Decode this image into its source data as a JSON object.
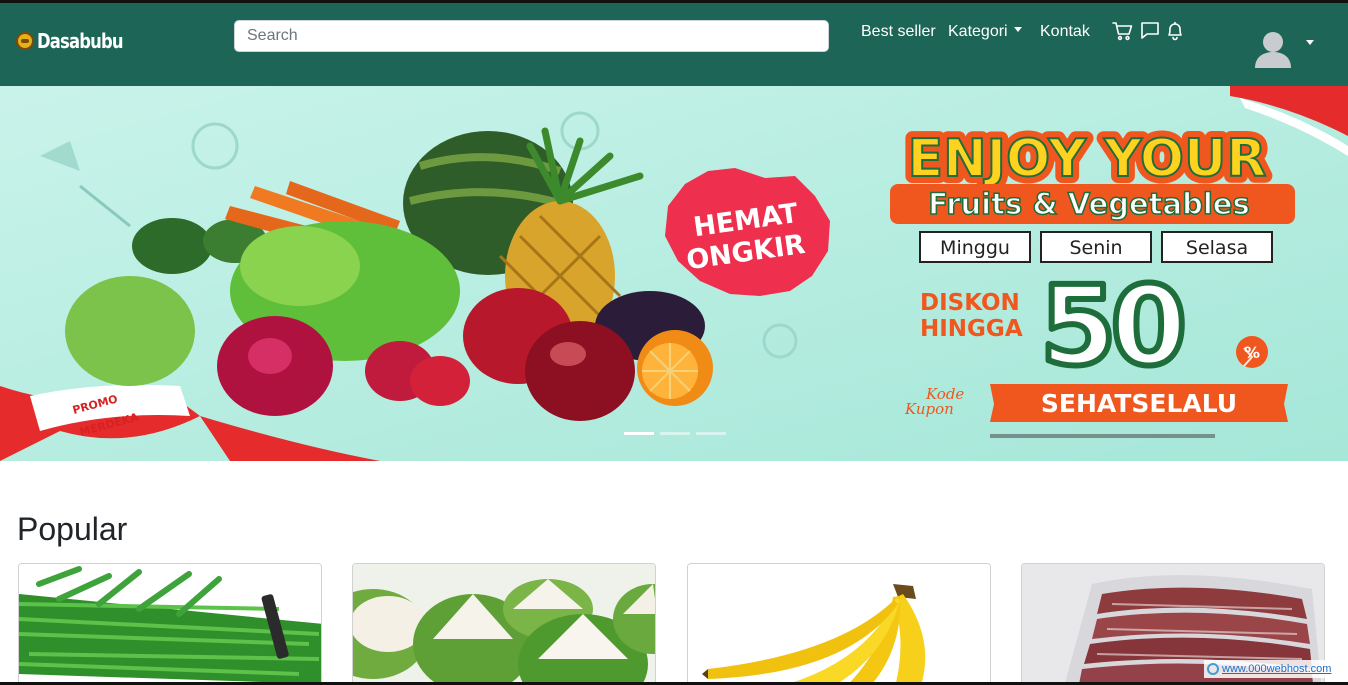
{
  "brand": {
    "name": "Dasabubu",
    "logo_icon": "brand-logo-icon"
  },
  "search": {
    "placeholder": "Search",
    "value": ""
  },
  "nav": {
    "best_seller": "Best seller",
    "kategori": "Kategori",
    "kontak": "Kontak",
    "icons": [
      "cart-icon",
      "chat-icon",
      "bell-icon"
    ]
  },
  "user_menu": {
    "icon": "user-avatar-icon"
  },
  "hero": {
    "headline": "ENJOY YOUR",
    "subheadline": "Fruits & Vegetables",
    "days": [
      "Minggu",
      "Senin",
      "Selasa"
    ],
    "discount_label_line1": "DISKON",
    "discount_label_line2": "HINGGA",
    "discount_value": "50",
    "discount_unit": "%",
    "coupon_label_line1": "Kode",
    "coupon_label_line2": "Kupon",
    "coupon_code": "SEHATSELALU",
    "badge_line1": "HEMAT",
    "badge_line2": "ONGKIR",
    "promo_line1": "PROMO",
    "promo_line2": "MERDEKA",
    "slide_count": 3,
    "active_slide": 1
  },
  "popular": {
    "title": "Popular",
    "products": [
      {
        "image": "kangkung"
      },
      {
        "image": "kelapa-muda"
      },
      {
        "image": "pisang"
      },
      {
        "image": "daging"
      }
    ]
  },
  "watermark": {
    "text": "www.000webhost.com"
  },
  "colors": {
    "navbar": "#1d6556",
    "hero_background": "#bfeee3",
    "accent_orange": "#f0571f",
    "accent_yellow": "#ffd21f"
  }
}
